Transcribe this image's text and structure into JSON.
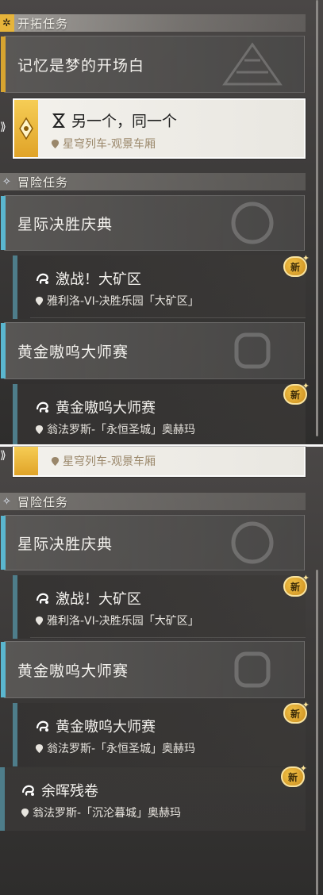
{
  "top": {
    "trailblaze_header": "开拓任务",
    "trailblaze_mission": "记忆是梦的开场白",
    "selected_quest": {
      "title": "另一个，同一个",
      "location": "星穹列车-观景车厢"
    },
    "adventure_header": "冒险任务",
    "groups": [
      {
        "title": "星际决胜庆典",
        "quest": {
          "title": "激战！大矿区",
          "location": "雅利洛-VI-决胜乐园「大矿区」",
          "badge": "新"
        }
      },
      {
        "title": "黄金嗷呜大师赛",
        "quest": {
          "title": "黄金嗷呜大师赛",
          "location": "翁法罗斯-「永恒圣城」奥赫玛",
          "badge": "新"
        }
      }
    ]
  },
  "bottom": {
    "selected_location": "星穹列车-观景车厢",
    "adventure_header": "冒险任务",
    "groups": [
      {
        "title": "星际决胜庆典",
        "quest": {
          "title": "激战！大矿区",
          "location": "雅利洛-VI-决胜乐园「大矿区」",
          "badge": "新"
        }
      },
      {
        "title": "黄金嗷呜大师赛",
        "quest": {
          "title": "黄金嗷呜大师赛",
          "location": "翁法罗斯-「永恒圣城」奥赫玛",
          "badge": "新"
        }
      }
    ],
    "extra_quest": {
      "title": "余晖残卷",
      "location": "翁法罗斯-「沉沦暮城」奥赫玛",
      "badge": "新"
    }
  },
  "colors": {
    "gold_accent": "#d7a430",
    "blue_accent": "#5ab6cf",
    "badge": "#e0a328"
  },
  "icons": {
    "quest_type": "adventure-quest-icon",
    "trailblaze": "trailblaze-emblem-icon",
    "location": "map-pin-icon",
    "hourglass": "hourglass-icon"
  }
}
